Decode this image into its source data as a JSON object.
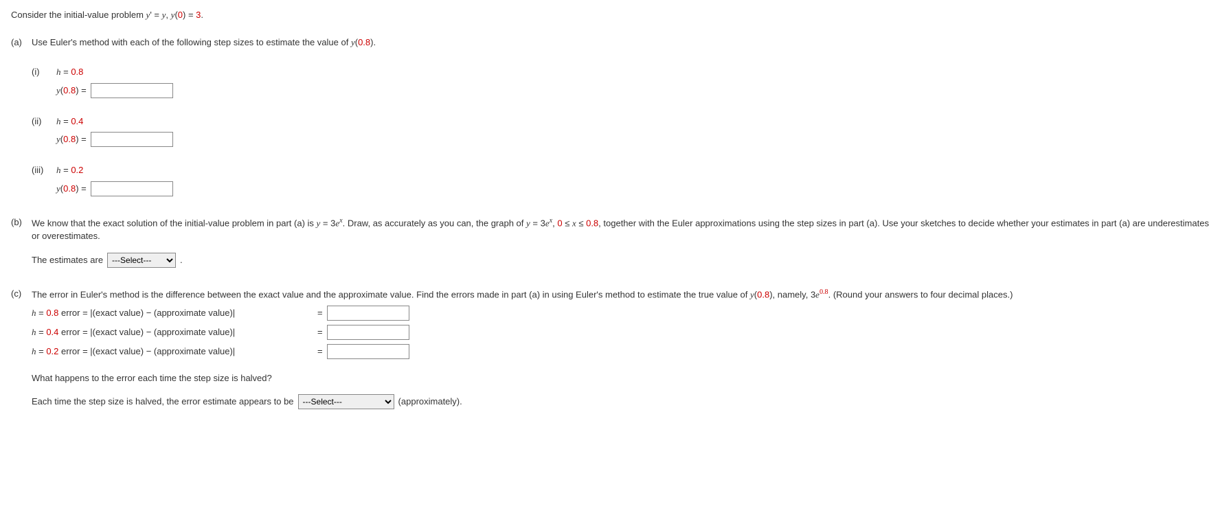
{
  "intro": {
    "t1": "Consider the initial-value problem ",
    "t2": "y",
    "t3": "' = ",
    "t4": "y",
    "t5": ", ",
    "t6": "y",
    "t7": "(",
    "t8": "0",
    "t9": ") = ",
    "t10": "3",
    "t11": "."
  },
  "partA": {
    "label": "(a)",
    "text1": "Use Euler's method with each of the following step sizes to estimate the value of ",
    "yfunc": "y",
    "yparen1": "(",
    "yval": "0.8",
    "yparen2": ").",
    "sub_i": {
      "label": "(i)",
      "hvar": "h",
      "eq": " = ",
      "hval": "0.8",
      "yfunc": "y",
      "paren1": "(",
      "arg": "0.8",
      "paren2": ") ="
    },
    "sub_ii": {
      "label": "(ii)",
      "hvar": "h",
      "eq": " = ",
      "hval": "0.4",
      "yfunc": "y",
      "paren1": "(",
      "arg": "0.8",
      "paren2": ") ="
    },
    "sub_iii": {
      "label": "(iii)",
      "hvar": "h",
      "eq": " = ",
      "hval": "0.2",
      "yfunc": "y",
      "paren1": "(",
      "arg": "0.8",
      "paren2": ") ="
    }
  },
  "partB": {
    "label": "(b)",
    "t1": "We know that the exact solution of the initial-value problem in part (a) is ",
    "y1": "y",
    "eq1": " = 3",
    "e1": "e",
    "x1": "x",
    "t2": ". Draw, as accurately as you can, the graph of ",
    "y2": "y",
    "eq2": " = 3",
    "e2": "e",
    "x2": "x",
    "comma": ", ",
    "range1": "0",
    "le1": " ≤ ",
    "xvar": "x",
    "le2": " ≤ ",
    "range2": "0.8",
    "t3": ", together with the Euler approximations using the step sizes in part (a). Use your sketches to decide whether your estimates in part (a) are underestimates or overestimates.",
    "est_text": "The estimates are",
    "select_default": "---Select---",
    "period": "."
  },
  "partC": {
    "label": "(c)",
    "t1": "The error in Euler's method is the difference between the exact value and the approximate value. Find the errors made in part (a) in using Euler's method to estimate the true value of ",
    "yfunc": "y",
    "paren1": "(",
    "arg": "0.8",
    "paren2": "), namely, 3",
    "e": "e",
    "exp": "0.8",
    "t2": ". (Round your answers to four decimal places.)",
    "err1": {
      "hvar": "h",
      "eqh": " = ",
      "hval": "0.8",
      "label": " error = |(exact value) − (approximate value)|",
      "eq": "="
    },
    "err2": {
      "hvar": "h",
      "eqh": " = ",
      "hval": "0.4",
      "label": " error = |(exact value) − (approximate value)|",
      "eq": "="
    },
    "err3": {
      "hvar": "h",
      "eqh": " = ",
      "hval": "0.2",
      "label": " error = |(exact value) − (approximate value)|",
      "eq": "="
    },
    "q_text": "What happens to the error each time the step size is halved?",
    "final_t1": "Each time the step size is halved, the error estimate appears to be",
    "select_default": "---Select---",
    "final_t2": "(approximately)."
  }
}
